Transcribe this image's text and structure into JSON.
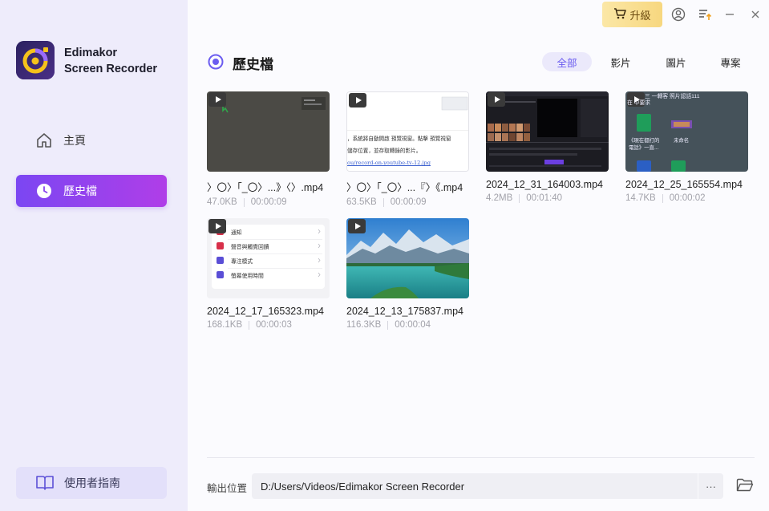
{
  "app": {
    "name_line1": "Edimakor",
    "name_line2": "Screen Recorder"
  },
  "sidebar": {
    "items": [
      {
        "label": "主頁",
        "icon": "home-icon",
        "active": false
      },
      {
        "label": "歷史檔",
        "icon": "clock-icon",
        "active": true
      }
    ],
    "guide_label": "使用者指南"
  },
  "titlebar": {
    "upgrade_label": "升級",
    "upgrade_icon": "cart-icon",
    "icons": [
      "account-icon",
      "update-list-icon",
      "minimize-icon",
      "close-icon"
    ]
  },
  "main": {
    "title": "歷史檔",
    "filters": [
      {
        "label": "全部",
        "active": true
      },
      {
        "label": "影片",
        "active": false
      },
      {
        "label": "圖片",
        "active": false
      },
      {
        "label": "專案",
        "active": false
      }
    ],
    "files": [
      {
        "name": "〉〇〉「_〇〉...》〈〉.mp4",
        "size": "47.0KB",
        "duration": "00:00:09",
        "thumb": "dark-gray-app"
      },
      {
        "name": "〉〇〉「_〇〉...『〉《.mp4",
        "size": "63.5KB",
        "duration": "00:00:09",
        "thumb": "document-page"
      },
      {
        "name": "2024_12_31_164003.mp4",
        "size": "4.2MB",
        "duration": "00:01:40",
        "thumb": "video-editor"
      },
      {
        "name": "2024_12_25_165554.mp4",
        "size": "14.7KB",
        "duration": "00:00:02",
        "thumb": "desktop-files"
      },
      {
        "name": "2024_12_17_165323.mp4",
        "size": "168.1KB",
        "duration": "00:00:03",
        "thumb": "settings-list"
      },
      {
        "name": "2024_12_13_175837.mp4",
        "size": "116.3KB",
        "duration": "00:00:04",
        "thumb": "mountain-lake"
      }
    ],
    "thumb_text": {
      "doc_line1": "，系統將自動開啟 預覽視窗。點擊 預覽視窗",
      "doc_line2": "儲存位置，並存取轉錄的影片。",
      "doc_link": "ou/record-on-youtube-tv-12.jpg",
      "settings": [
        "通知",
        "聲音與觸覺回饋",
        "專注模式",
        "螢幕使用時間"
      ],
      "desktop_top": "三 一轉客   照片認話111",
      "desktop_sub": "在 中要求",
      "desktop_label1": "《現在都打的",
      "desktop_label2": "電話》一直...",
      "desktop_label3": "未命名"
    }
  },
  "footer": {
    "output_label": "輸出位置",
    "output_path": "D:/Users/Videos/Edimakor Screen Recorder",
    "more_label": "···"
  }
}
